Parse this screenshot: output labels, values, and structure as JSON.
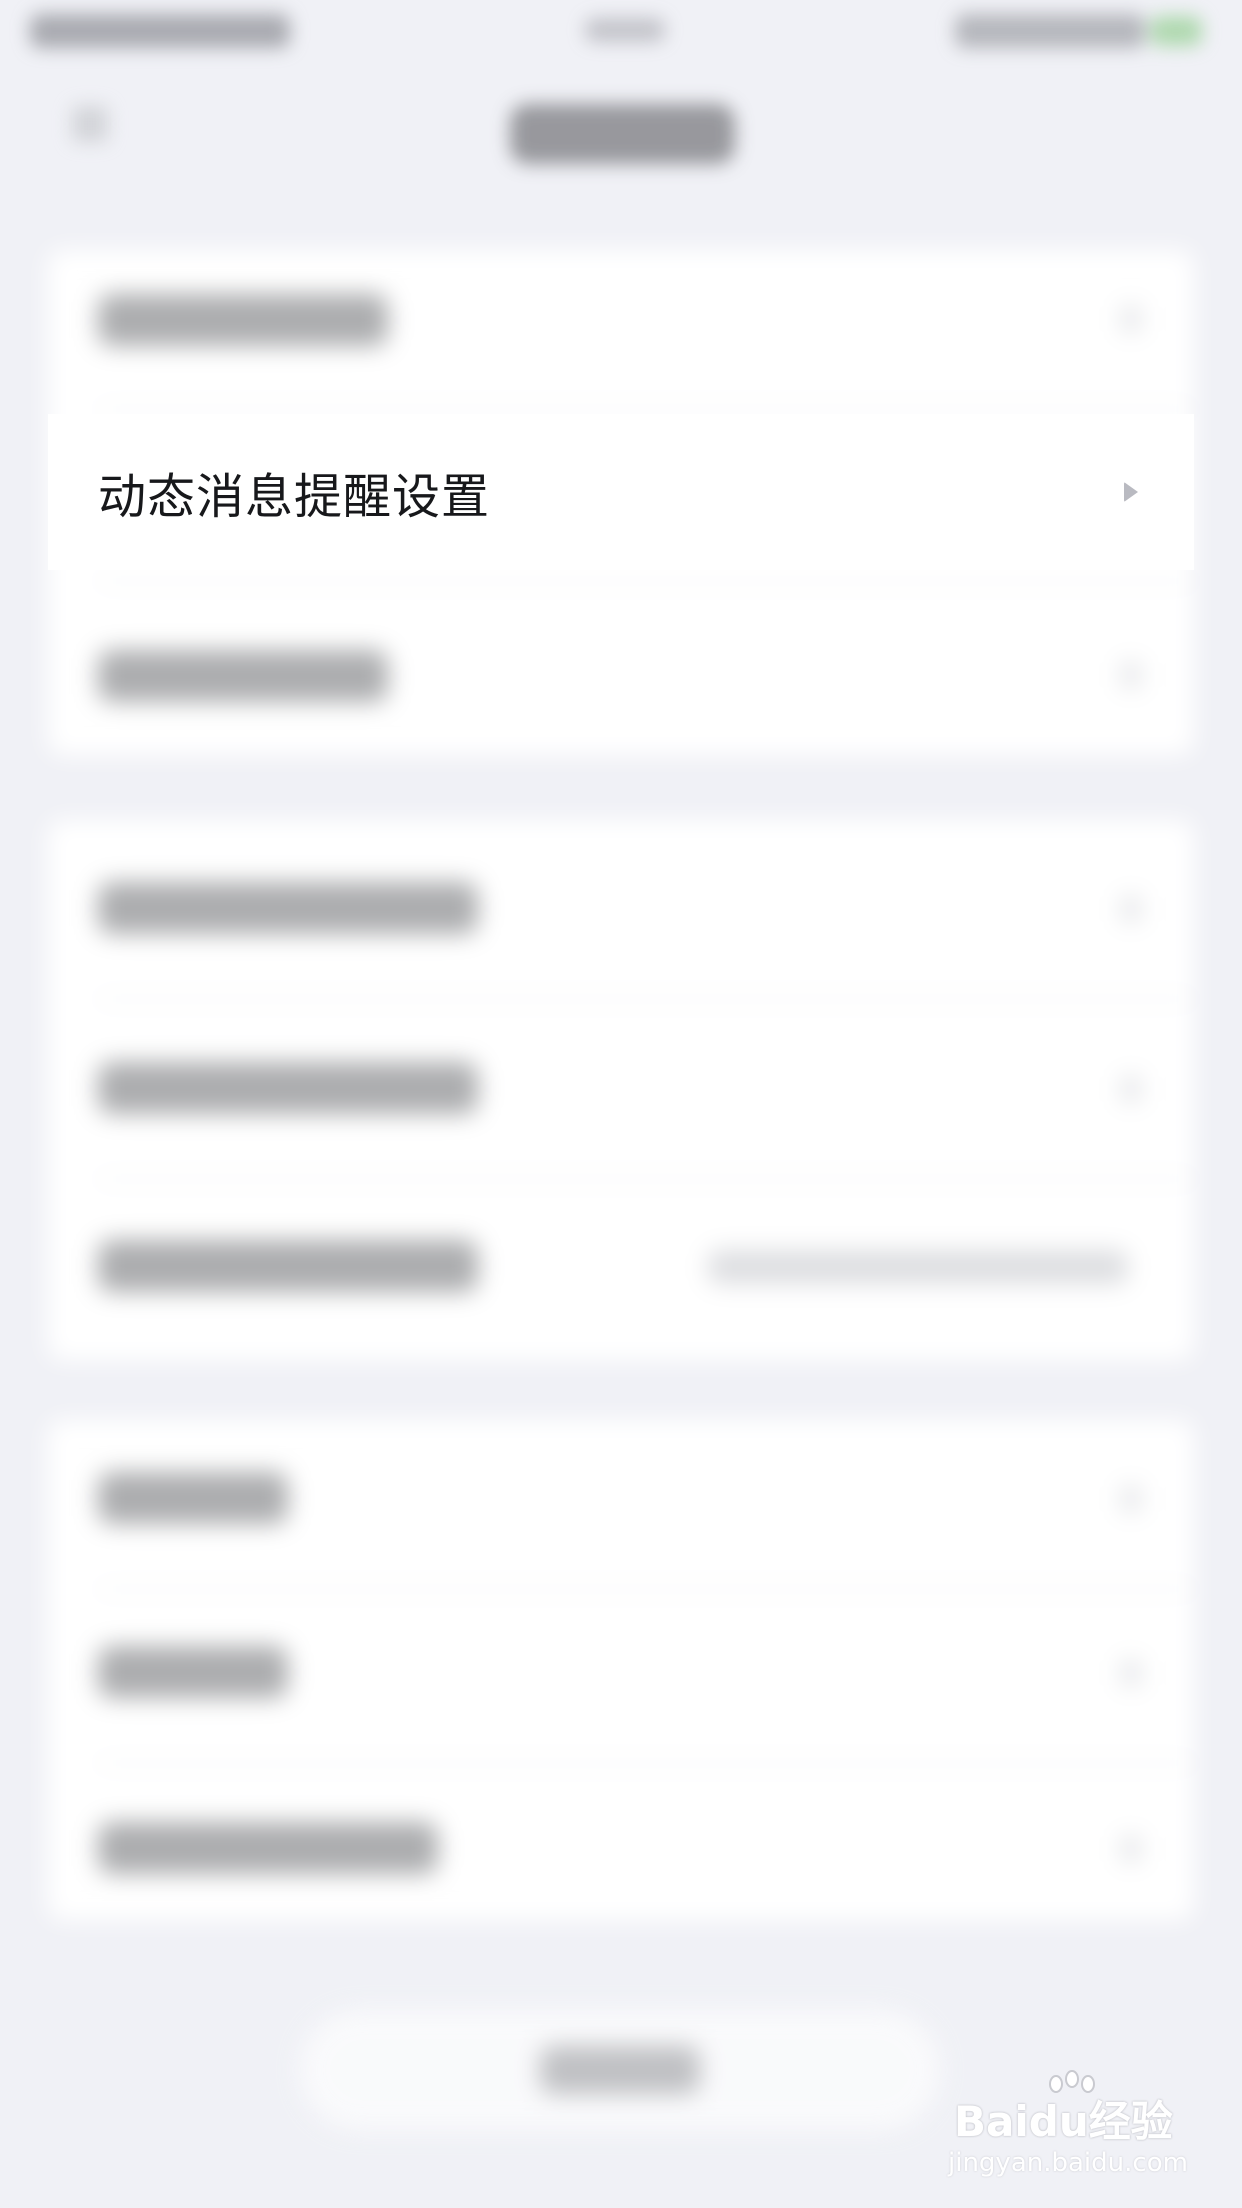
{
  "focused_row": {
    "label": "动态消息提醒设置"
  },
  "watermark": {
    "brand": "Baidu经验",
    "site": "jingyan.baidu.com"
  }
}
